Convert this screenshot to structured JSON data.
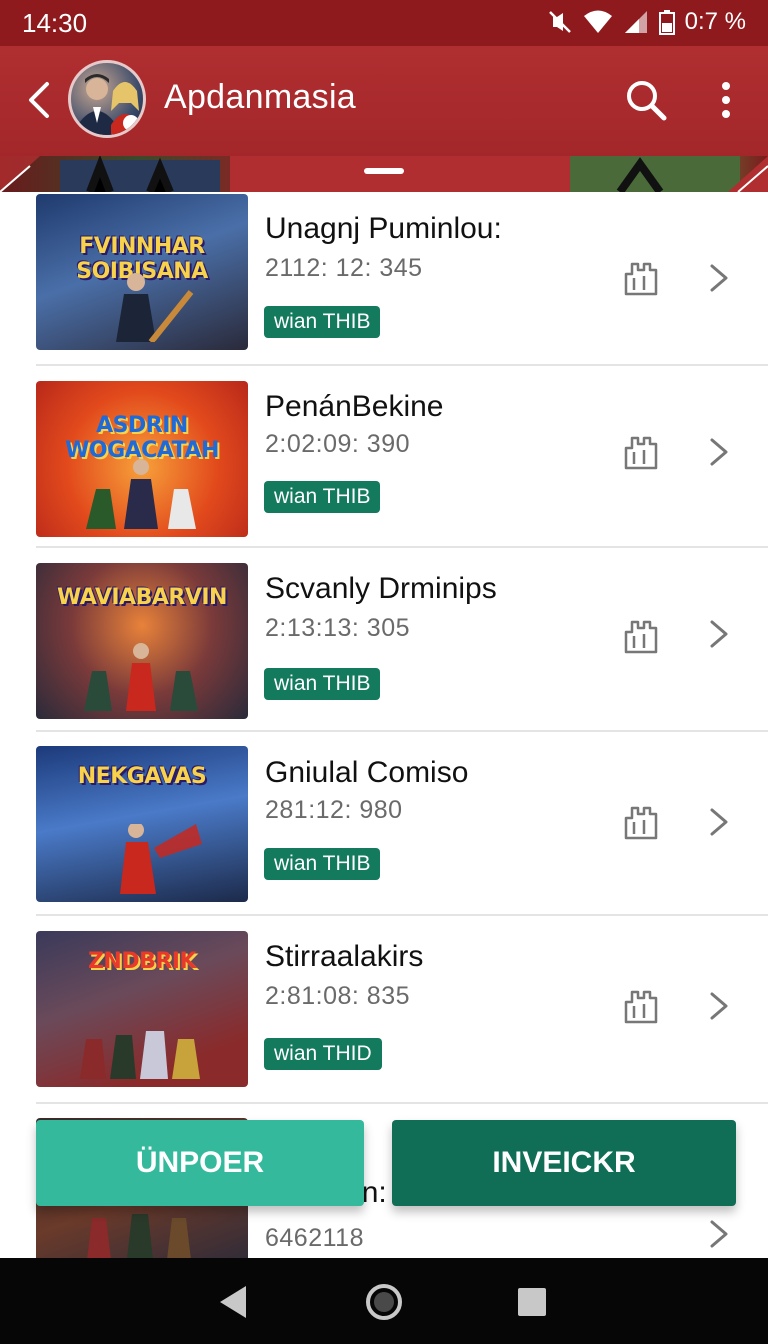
{
  "status_bar": {
    "time": "14:30",
    "battery": "0:7 %"
  },
  "app_bar": {
    "title": "Apdanmasia"
  },
  "items": [
    {
      "title": "Unagnj Puminlou:",
      "time": "2112: 12: 345",
      "badge": "wian THIB",
      "thumb_art": "FVINNHAR SOIBISANA",
      "thumb_colors": [
        "#1f3a6e",
        "#4a6fa8",
        "#c88a3a"
      ]
    },
    {
      "title": "PenánBekine",
      "time": "2:02:09: 390",
      "badge": "wian THIB",
      "thumb_art": "ASDRIN WOGACATAH",
      "thumb_colors": [
        "#e24a1c",
        "#f2822a",
        "#3a2a6a"
      ]
    },
    {
      "title": "Scvanly Drminips",
      "time": "2:13:13: 305",
      "badge": "wian THIB",
      "thumb_art": "WAVIABARVIN",
      "thumb_colors": [
        "#3a2a5a",
        "#c65a2a",
        "#2a4a3a"
      ]
    },
    {
      "title": "Gniulal Comiso",
      "time": "281:12: 980",
      "badge": "wian THIB",
      "thumb_art": "NEKGAVAS",
      "thumb_colors": [
        "#1c3a7a",
        "#4a7ac8",
        "#c8281e"
      ]
    },
    {
      "title": "Stirraalakirs",
      "time": "2:81:08: 835",
      "badge": "wian THID",
      "thumb_art": "ZNDBRIK",
      "thumb_colors": [
        "#3a3a5a",
        "#8a2a2a",
        "#c8a23a"
      ]
    },
    {
      "title": "Sutotarn:",
      "time": "6462118",
      "badge": "",
      "thumb_art": "",
      "thumb_colors": [
        "#3a2a2a",
        "#6a3a2a",
        "#2a2a3a"
      ]
    }
  ],
  "buttons": {
    "left": "ÜNPOER",
    "right": "INVEICKR"
  }
}
